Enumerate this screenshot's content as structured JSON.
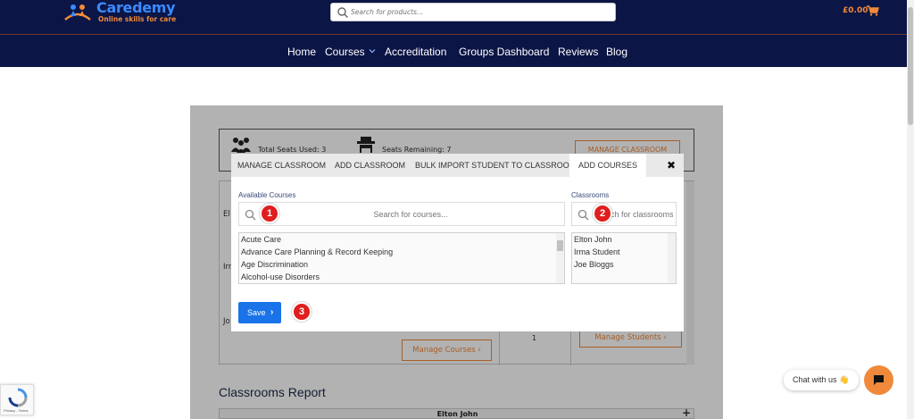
{
  "brand": {
    "name": "Caredemy",
    "tagline": "Online skills for care"
  },
  "header": {
    "search_placeholder": "Search for products...",
    "cart_total": "£0.00"
  },
  "nav": {
    "items": [
      "Home",
      "Courses",
      "Accreditation",
      "Groups Dashboard",
      "Reviews",
      "Blog"
    ]
  },
  "seats": {
    "used_label": "Total Seats Used: 3",
    "remaining_label": "Seats Remaining: 7",
    "manage_button": "MANAGE CLASSROOM"
  },
  "background_table": {
    "rows": [
      "El",
      "Irr",
      "Jo"
    ],
    "count": "1",
    "manage_courses": "Manage Courses",
    "manage_students": "Manage Students"
  },
  "report": {
    "title": "Classrooms Report",
    "first_row": "Elton John",
    "expand": "+"
  },
  "modal": {
    "tabs": [
      "MANAGE CLASSROOM",
      "ADD CLASSROOM",
      "BULK IMPORT STUDENT TO CLASSROOMS",
      "ADD COURSES"
    ],
    "active_tab": "ADD COURSES",
    "close": "✖",
    "available_label": "Available Courses",
    "available_placeholder": "Search for courses...",
    "courses": [
      "Acute Care",
      "Advance Care Planning & Record Keeping",
      "Age Discrimination",
      "Alcohol-use Disorders"
    ],
    "classrooms_label": "Classrooms",
    "classrooms_placeholder": "Search for classrooms...",
    "classrooms": [
      "Elton John",
      "Irma Student",
      "Joe Bloggs"
    ],
    "save": "Save",
    "save_chevron": "›",
    "badges": [
      "1",
      "2",
      "3"
    ]
  },
  "chat": {
    "label": "Chat with us 👋"
  },
  "recaptcha": {
    "text": "Privacy - Terms"
  },
  "colors": {
    "navy": "#0b1546",
    "orange": "#f0893a",
    "blue": "#1a73e8",
    "badge_red": "#e11d1d"
  }
}
